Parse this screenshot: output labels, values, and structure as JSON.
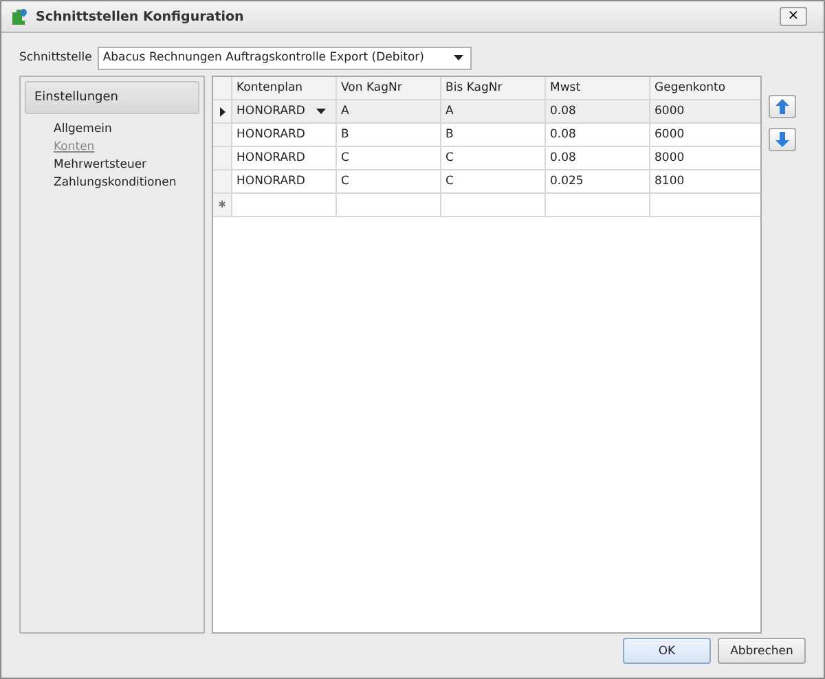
{
  "window": {
    "title": "Schnittstellen Konfiguration",
    "close": "×"
  },
  "interface": {
    "label": "Schnittstelle",
    "value": "Abacus Rechnungen Auftragskontrolle Export (Debitor)"
  },
  "sidebar": {
    "header": "Einstellungen",
    "items": [
      {
        "label": "Allgemein",
        "selected": false
      },
      {
        "label": "Konten",
        "selected": true
      },
      {
        "label": "Mehrwertsteuer",
        "selected": false
      },
      {
        "label": "Zahlungskonditionen",
        "selected": false
      }
    ]
  },
  "table": {
    "columns": [
      "Kontenplan",
      "Von KagNr",
      "Bis KagNr",
      "Mwst",
      "Gegenkonto"
    ],
    "rows": [
      {
        "cells": [
          "HONORARD",
          "A",
          "A",
          "0.08",
          "6000"
        ],
        "selected": true
      },
      {
        "cells": [
          "HONORARD",
          "B",
          "B",
          "0.08",
          "6000"
        ],
        "selected": false
      },
      {
        "cells": [
          "HONORARD",
          "C",
          "C",
          "0.08",
          "8000"
        ],
        "selected": false
      },
      {
        "cells": [
          "HONORARD",
          "C",
          "C",
          "0.025",
          "8100"
        ],
        "selected": false
      }
    ],
    "new_row_marker": "✱"
  },
  "buttons": [
    "OK",
    "Abbrechen"
  ]
}
